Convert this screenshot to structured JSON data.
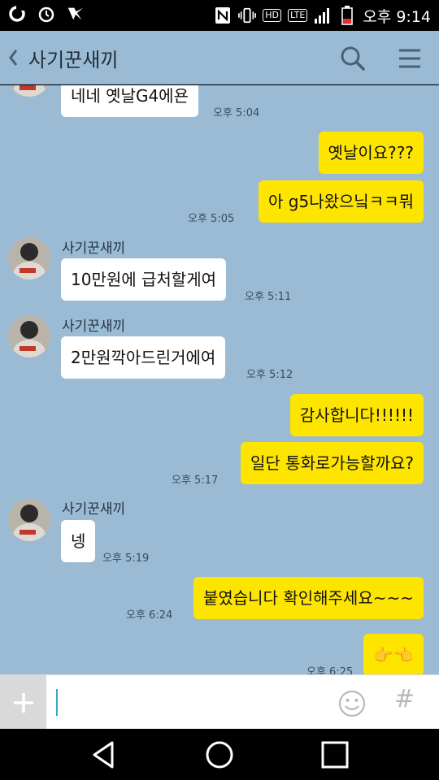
{
  "status_bar": {
    "clock": "오후 9:14",
    "network": "LTE",
    "hd_label": "HD",
    "icons": [
      "app-o-icon",
      "alarm-icon",
      "v3-icon",
      "nfc-icon",
      "vibrate-icon",
      "hd-icon",
      "lte-icon",
      "signal-icon",
      "battery-icon"
    ]
  },
  "header": {
    "title": "사기꾼새끼",
    "back_icon": "chevron-left-icon",
    "search_icon": "search-icon",
    "menu_icon": "hamburger-menu-icon"
  },
  "messages": [
    {
      "side": "in",
      "sender": "",
      "text": "네네 옛날G4에욘",
      "time": "오후 5:04"
    },
    {
      "side": "out",
      "text": "옛날이요???",
      "time": ""
    },
    {
      "side": "out",
      "text": "아 g5나왔으닠ㅋㅋ뭐",
      "time": "오후 5:05"
    },
    {
      "side": "in",
      "sender": "사기꾼새끼",
      "text": "10만원에 급처할게여",
      "time": "오후 5:11"
    },
    {
      "side": "in",
      "sender": "사기꾼새끼",
      "text": "2만원깍아드린거에여",
      "time": "오후 5:12"
    },
    {
      "side": "out",
      "text": "감사합니다!!!!!!",
      "time": ""
    },
    {
      "side": "out",
      "text": "일단 통화로가능할까요?",
      "time": "오후 5:17"
    },
    {
      "side": "in",
      "sender": "사기꾼새끼",
      "text": "넹",
      "time": "오후 5:19"
    },
    {
      "side": "out",
      "text": "붙였습니다 확인해주세요~~~",
      "time": "오후 6:24"
    },
    {
      "side": "out",
      "text": "👉👈",
      "time": "오후 6:25"
    }
  ],
  "input_bar": {
    "value": "",
    "plus_label": "+",
    "emoji_icon": "smiley-icon",
    "hash_label": "#"
  },
  "colors": {
    "chat_background": "#9bbbd4",
    "outgoing_bubble": "#fee500",
    "incoming_bubble": "#ffffff",
    "caret": "#3aa7c7"
  },
  "nav_bar": [
    "back-triangle-icon",
    "home-circle-icon",
    "recents-square-icon"
  ]
}
